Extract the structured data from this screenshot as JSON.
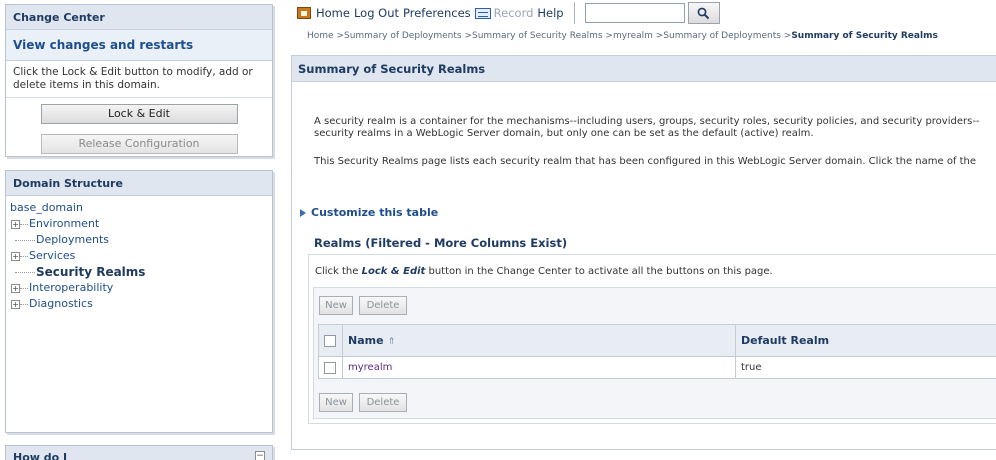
{
  "change_center": {
    "title": "Change Center",
    "view_link": "View changes and restarts",
    "message": "Click the Lock & Edit button to modify, add or delete items in this domain.",
    "lock_edit_label": "Lock & Edit",
    "release_label": "Release Configuration"
  },
  "domain_structure": {
    "title": "Domain Structure",
    "root": "base_domain",
    "items": [
      {
        "label": "Environment",
        "expandable": true
      },
      {
        "label": "Deployments",
        "expandable": false
      },
      {
        "label": "Services",
        "expandable": true
      },
      {
        "label": "Security Realms",
        "expandable": false,
        "active": true
      },
      {
        "label": "Interoperability",
        "expandable": true
      },
      {
        "label": "Diagnostics",
        "expandable": true
      }
    ],
    "expand_glyph": "⊞"
  },
  "how_do_i": {
    "title": "How do I",
    "collapse_glyph": "⊟"
  },
  "toolbar": {
    "home": "Home",
    "logout": "Log Out",
    "preferences": "Preferences",
    "record": "Record",
    "help": "Help",
    "search_value": "",
    "search_icon": "🔍"
  },
  "breadcrumb": {
    "trail": "Home >Summary of Deployments >Summary of Security Realms >myrealm >Summary of Deployments >",
    "current": "Summary of Security Realms"
  },
  "page": {
    "title": "Summary of Security Realms",
    "intro_line1": "A security realm is a container for the mechanisms--including users, groups, security roles, security policies, and security providers--",
    "intro_line2": "security realms in a WebLogic Server domain, but only one can be set as the default (active) realm.",
    "list_text": "This Security Realms page lists each security realm that has been configured in this WebLogic Server domain. Click the name of the",
    "customize": "Customize this table"
  },
  "realms": {
    "heading": "Realms (Filtered - More Columns Exist)",
    "instr_prefix": "Click the ",
    "instr_em": "Lock & Edit",
    "instr_suffix": " button in the Change Center to activate all the buttons on this page.",
    "new_label": "New",
    "delete_label": "Delete",
    "columns": [
      "Name",
      "Default Realm"
    ],
    "sort_glyph": "⇑",
    "rows": [
      {
        "name": "myrealm",
        "default": "true"
      }
    ]
  },
  "colors": {
    "header_bg": "#dfe6ef",
    "title_text": "#1f3b62",
    "link": "#1f4e8c",
    "visited_link": "#5b2d8a"
  }
}
